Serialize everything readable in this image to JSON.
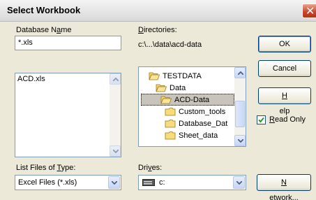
{
  "window": {
    "title": "Select Workbook"
  },
  "database_name": {
    "label_pre": "Database N",
    "label_acc": "a",
    "label_post": "me",
    "value": "*.xls",
    "files": [
      "ACD.xls"
    ]
  },
  "directories": {
    "label_acc": "D",
    "label_post": "irectories:",
    "path": "c:\\...\\data\\acd-data",
    "items": [
      "TESTDATA",
      "Data",
      "ACD-Data",
      "Custom_tools",
      "Database_Dat",
      "Sheet_data"
    ]
  },
  "file_type": {
    "label_pre": "List Files of ",
    "label_acc": "T",
    "label_post": "ype:",
    "value": "Excel Files (*.xls)"
  },
  "drives": {
    "label_pre": "Dri",
    "label_acc": "v",
    "label_post": "es:",
    "value": "c:"
  },
  "buttons": {
    "ok": "OK",
    "cancel": "Cancel",
    "help_acc": "H",
    "help_post": "elp",
    "network_acc": "N",
    "network_post": "etwork..."
  },
  "read_only": {
    "acc": "R",
    "post": "ead Only",
    "checked": true
  },
  "icons": [
    "close-icon",
    "folder-open-icon",
    "folder-closed-icon",
    "drive-icon",
    "checkmark-icon",
    "arrow-up-icon",
    "arrow-down-icon"
  ]
}
